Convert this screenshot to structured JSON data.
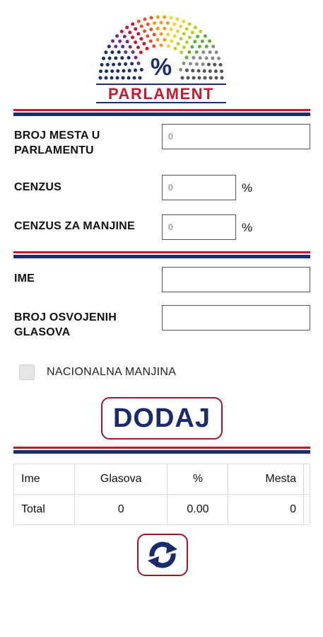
{
  "logo": {
    "symbol": "%",
    "wordmark": "PARLAMENT",
    "colors": {
      "blue": "#1c2d6e",
      "red": "#c41b2e"
    }
  },
  "settings": {
    "seats_label": "BROJ MESTA U PARLAMENTU",
    "seats_value": "0",
    "threshold_label": "CENZUS",
    "threshold_value": "0",
    "threshold_unit": "%",
    "minority_threshold_label": "CENZUS ZA MANJINE",
    "minority_threshold_value": "0",
    "minority_threshold_unit": "%"
  },
  "party_form": {
    "name_label": "IME",
    "name_value": "",
    "votes_label": "BROJ OSVOJENIH GLASOVA",
    "votes_value": "",
    "minority_checkbox_label": "NACIONALNA MANJINA",
    "minority_checked": false,
    "add_button_label": "DODAJ"
  },
  "results": {
    "headers": [
      "Ime",
      "Glasova",
      "%",
      "Mesta"
    ],
    "rows": [
      [
        "Total",
        "0",
        "0.00",
        "0"
      ]
    ]
  },
  "refresh_button": {
    "icon": "refresh-icon"
  }
}
